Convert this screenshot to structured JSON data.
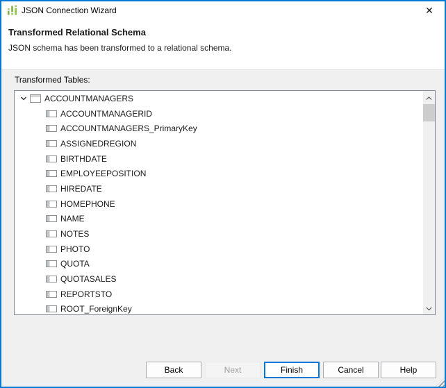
{
  "window": {
    "title": "JSON Connection Wizard",
    "close_glyph": "✕"
  },
  "header": {
    "title": "Transformed Relational Schema",
    "subtitle": "JSON schema has been transformed to a relational schema."
  },
  "main": {
    "tables_label": "Transformed Tables:",
    "tree": {
      "root_label": "ACCOUNTMANAGERS",
      "root_expanded": true,
      "columns": [
        "ACCOUNTMANAGERID",
        "ACCOUNTMANAGERS_PrimaryKey",
        "ASSIGNEDREGION",
        "BIRTHDATE",
        "EMPLOYEEPOSITION",
        "HIREDATE",
        "HOMEPHONE",
        "NAME",
        "NOTES",
        "PHOTO",
        "QUOTA",
        "QUOTASALES",
        "REPORTSTO",
        "ROOT_ForeignKey"
      ]
    },
    "scrollbar": {
      "up_icon": "chevron-up",
      "down_icon": "chevron-down",
      "thumb_visible": true
    }
  },
  "footer": {
    "buttons": [
      {
        "label": "Back",
        "state": "enabled"
      },
      {
        "label": "Next",
        "state": "disabled"
      },
      {
        "label": "Finish",
        "state": "default"
      },
      {
        "label": "Cancel",
        "state": "enabled"
      },
      {
        "label": "Help",
        "state": "enabled"
      }
    ]
  },
  "icons": {
    "app": "equalizer-icon",
    "root_expander": "chevron-down",
    "root_node": "table-icon",
    "child_node": "column-icon"
  },
  "colors": {
    "accent_border": "#0079d7",
    "finish_border": "#0078d7",
    "body_bg": "#f0f0f0",
    "listbox_border": "#828790",
    "scroll_thumb": "#cdcdcd",
    "icon_green_light": "#9ccc65",
    "icon_green_mid": "#8dc63f",
    "icon_green_dark": "#7cb342"
  }
}
